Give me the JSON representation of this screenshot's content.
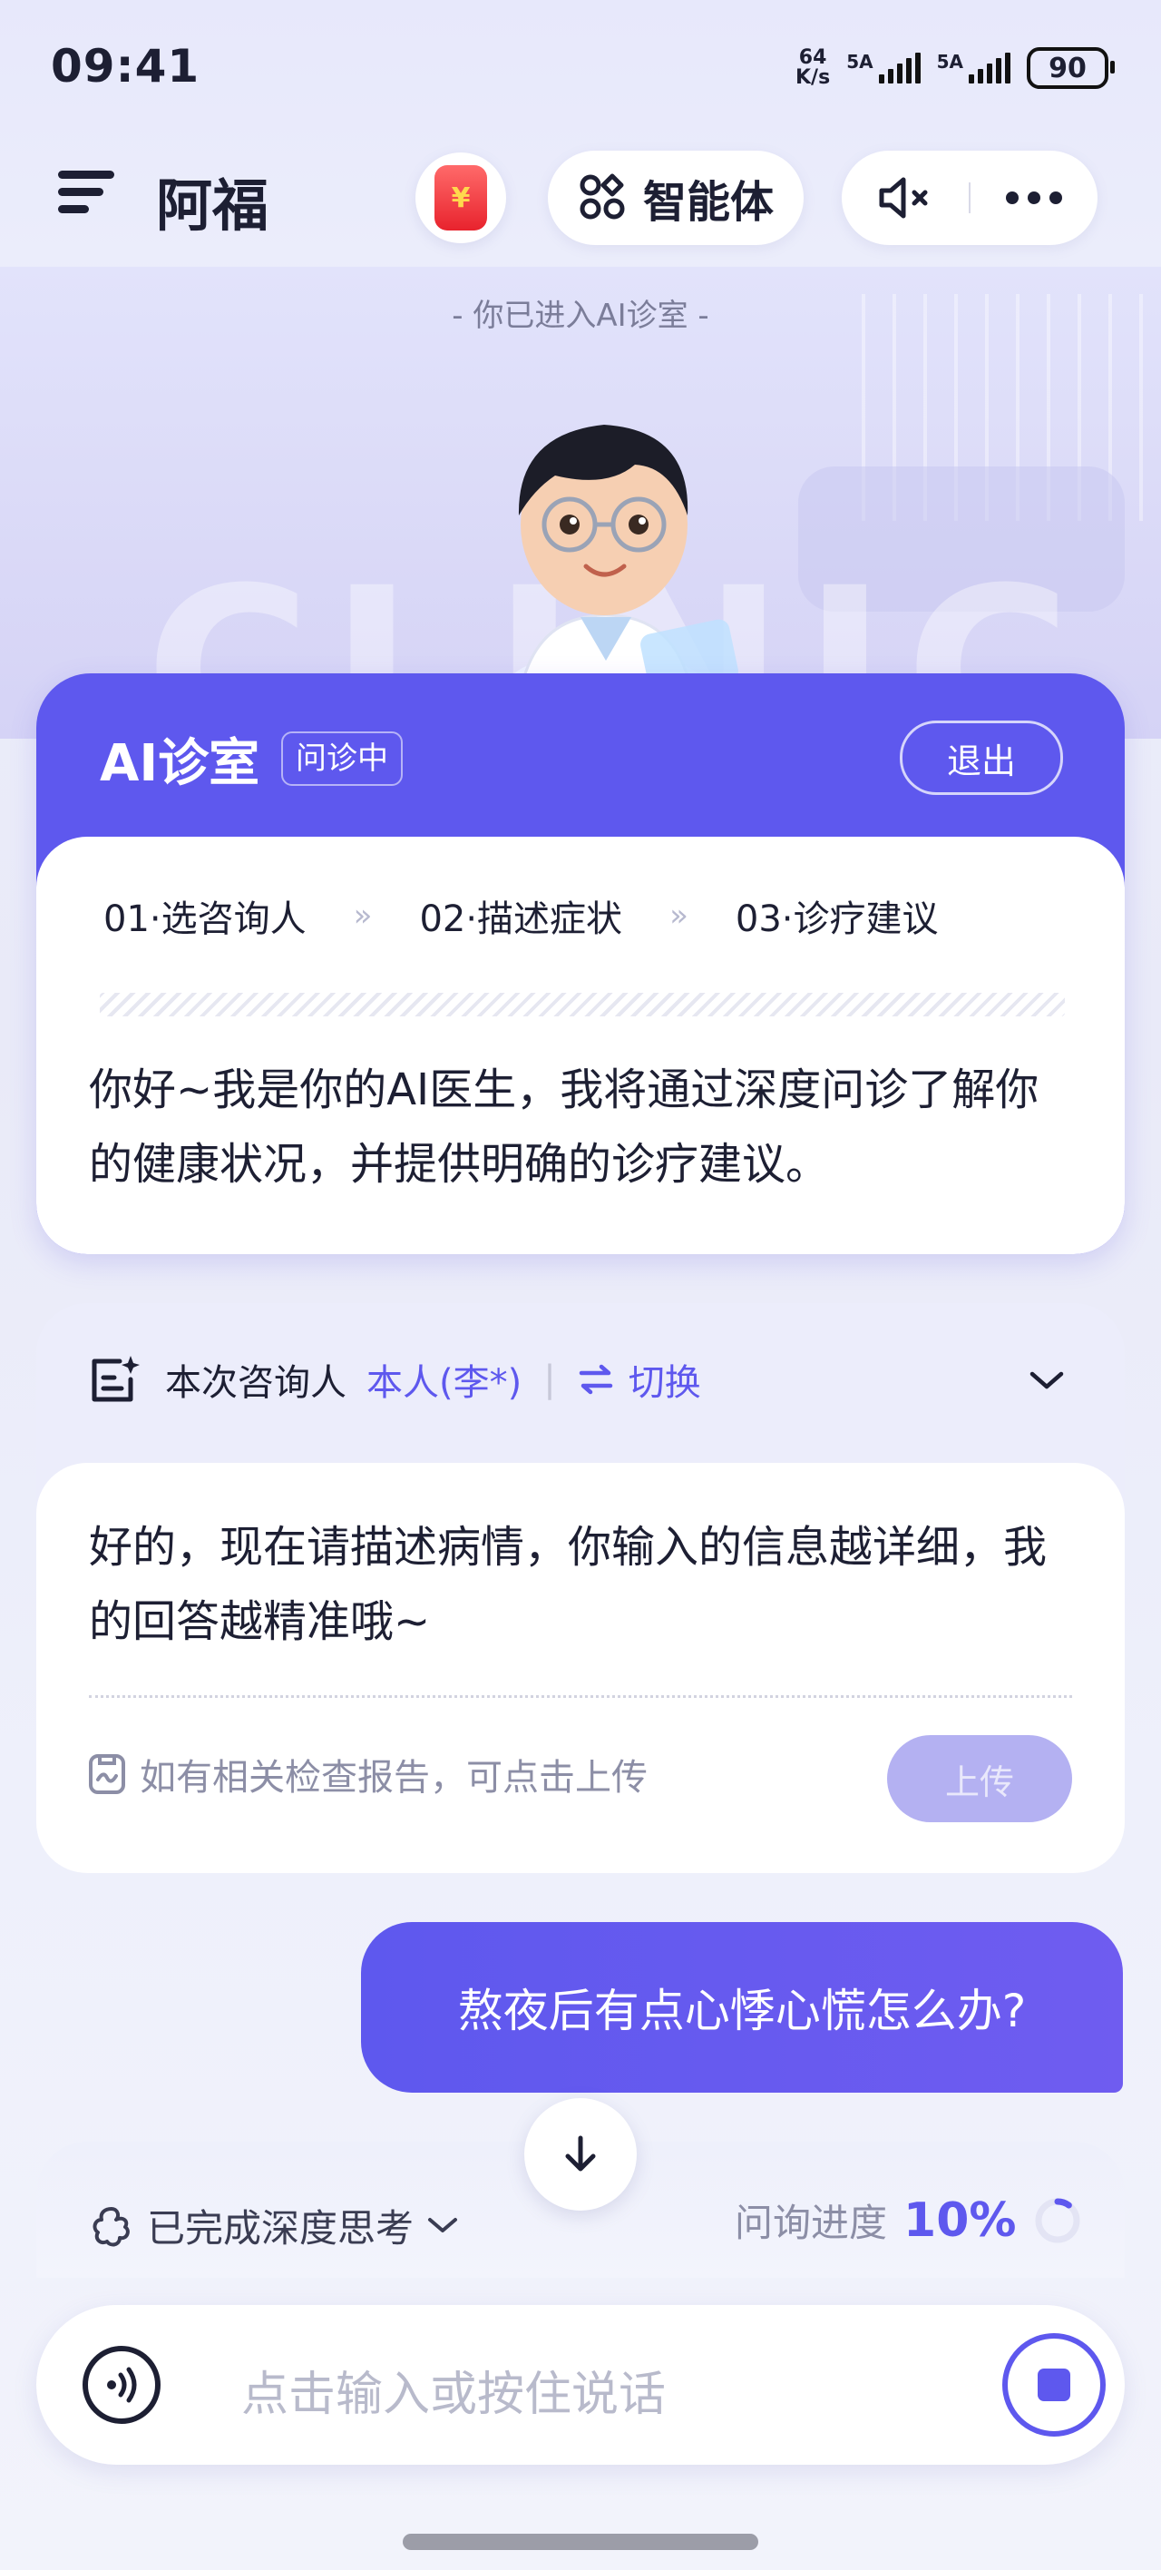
{
  "status_bar": {
    "time": "09:41",
    "net_speed_top": "64",
    "net_speed_unit": "K/s",
    "sim1": "5A",
    "sim2": "5A",
    "battery": "90"
  },
  "header": {
    "app_name": "阿福",
    "agent_label": "智能体",
    "redpack_symbol": "¥"
  },
  "hero": {
    "entered_text": "-  你已进入AI诊室  -",
    "background_word": "CLINIC"
  },
  "clinic": {
    "title": "AI诊室",
    "status_badge": "问诊中",
    "exit_label": "退出",
    "steps": [
      "01·选咨询人",
      "02·描述症状",
      "03·诊疗建议"
    ],
    "step_arrow": "»",
    "intro": "你好~我是你的AI医生，我将通过深度问诊了解你的健康状况，并提供明确的诊疗建议。"
  },
  "consult": {
    "label": "本次咨询人",
    "person": "本人(李*)",
    "divider": "|",
    "switch_label": "切换",
    "reply": "好的，现在请描述病情，你输入的信息越详细，我的回答越精准哦~",
    "upload_hint": "如有相关检查报告，可点击上传",
    "upload_label": "上传"
  },
  "chat": {
    "user_message": "熬夜后有点心悸心慌怎么办?"
  },
  "thinking": {
    "label": "已完成深度思考",
    "progress_label": "问询进度",
    "progress_value": "10%",
    "progress_fraction": 0.1
  },
  "input": {
    "placeholder": "点击输入或按住说话"
  },
  "colors": {
    "accent": "#5e58ee",
    "upload_disabled": "#b4b1f2"
  }
}
